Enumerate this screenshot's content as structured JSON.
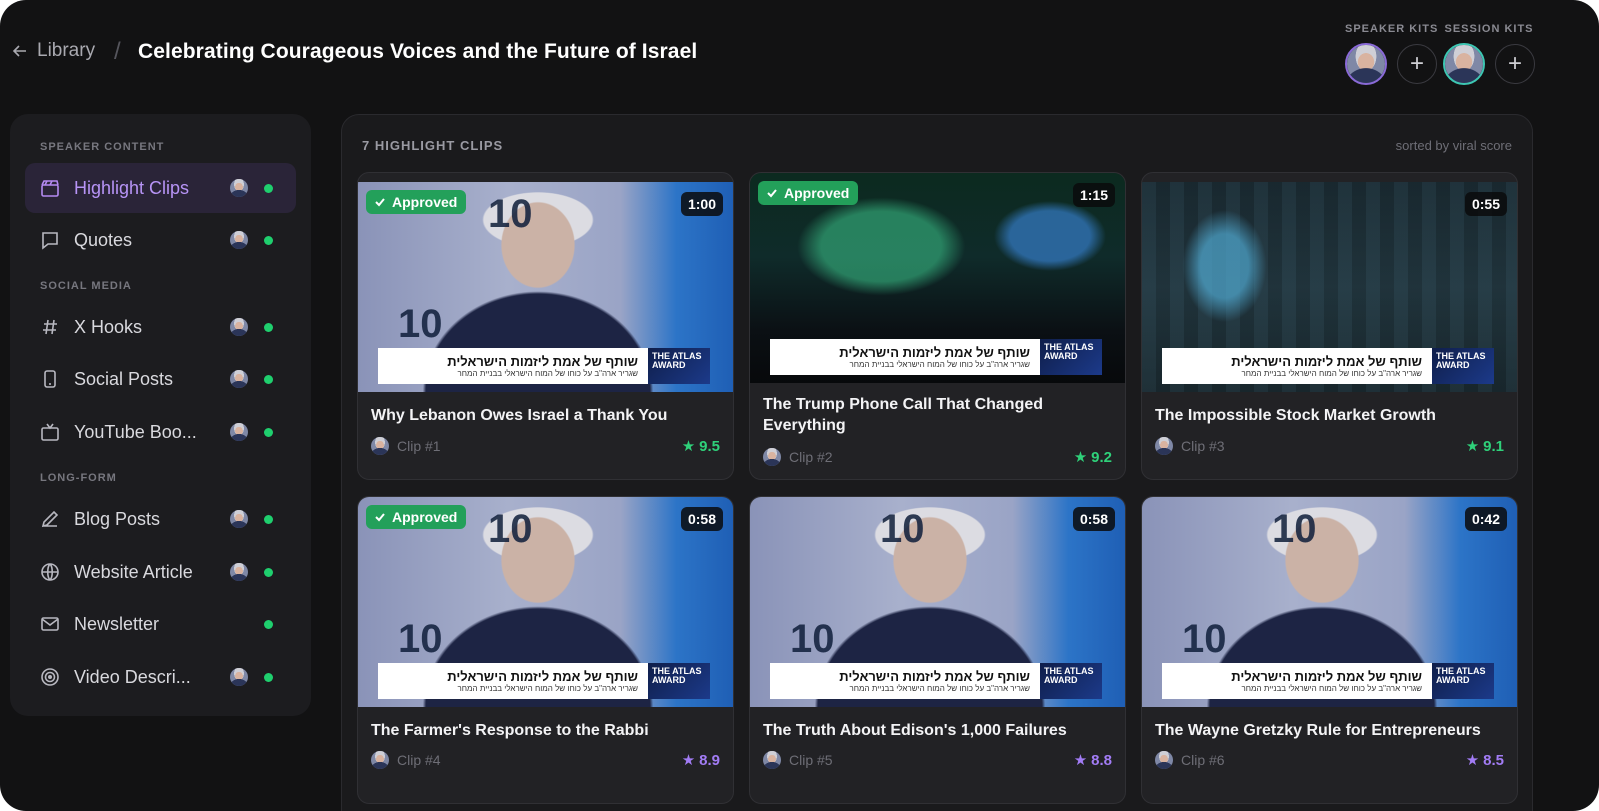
{
  "header": {
    "back_label": "Library",
    "title": "Celebrating Courageous Voices and the Future of Israel",
    "speaker_kits_label": "SPEAKER KITS",
    "session_kits_label": "SESSION KITS"
  },
  "sidebar": {
    "sections": {
      "speaker_content": "SPEAKER CONTENT",
      "social_media": "SOCIAL MEDIA",
      "long_form": "LONG-FORM"
    },
    "items": [
      {
        "label": "Highlight Clips",
        "icon": "clapperboard-icon",
        "active": true,
        "avatar": true
      },
      {
        "label": "Quotes",
        "icon": "speech-bubble-icon",
        "active": false,
        "avatar": true
      },
      {
        "label": "X Hooks",
        "icon": "hashtag-icon",
        "active": false,
        "avatar": true
      },
      {
        "label": "Social Posts",
        "icon": "phone-icon",
        "active": false,
        "avatar": true
      },
      {
        "label": "YouTube Boo...",
        "icon": "tv-icon",
        "active": false,
        "avatar": true
      },
      {
        "label": "Blog Posts",
        "icon": "pen-icon",
        "active": false,
        "avatar": true
      },
      {
        "label": "Website Article",
        "icon": "globe-icon",
        "active": false,
        "avatar": true
      },
      {
        "label": "Newsletter",
        "icon": "mail-icon",
        "active": false,
        "avatar": false
      },
      {
        "label": "Video Descri...",
        "icon": "target-icon",
        "active": false,
        "avatar": true
      }
    ],
    "status_color": "#1fcf6e"
  },
  "main": {
    "title": "7 HIGHLIGHT CLIPS",
    "sort_label": "sorted by viral score",
    "clips": [
      {
        "title": "Why Lebanon Owes Israel a Thank You",
        "clip": "Clip #1",
        "duration": "1:00",
        "score": "9.5",
        "approved": true,
        "approved_label": "Approved",
        "scene": "speaker",
        "score_color": "green"
      },
      {
        "title": "The Trump Phone Call That Changed Everything",
        "clip": "Clip #2",
        "duration": "1:15",
        "score": "9.2",
        "approved": true,
        "approved_label": "Approved",
        "scene": "stage",
        "score_color": "green"
      },
      {
        "title": "The Impossible Stock Market Growth",
        "clip": "Clip #3",
        "duration": "0:55",
        "score": "9.1",
        "approved": false,
        "approved_label": "",
        "scene": "crowd",
        "score_color": "green"
      },
      {
        "title": "The Farmer's Response to the Rabbi",
        "clip": "Clip #4",
        "duration": "0:58",
        "score": "8.9",
        "approved": true,
        "approved_label": "Approved",
        "scene": "speaker",
        "score_color": "purple"
      },
      {
        "title": "The Truth About Edison's 1,000 Failures",
        "clip": "Clip #5",
        "duration": "0:58",
        "score": "8.8",
        "approved": false,
        "approved_label": "",
        "scene": "speaker",
        "score_color": "purple"
      },
      {
        "title": "The Wayne Gretzky Rule for Entrepreneurs",
        "clip": "Clip #6",
        "duration": "0:42",
        "score": "8.5",
        "approved": false,
        "approved_label": "",
        "scene": "speaker",
        "score_color": "purple"
      }
    ],
    "banner_main": "שותף של אמת ליזמות הישראלית",
    "banner_sub": "שגריר ארה\"ב על כוחו של המוח הישראלי בבניית המחר",
    "banner_logo": "THE ATLAS AWARD",
    "backdrop_num": "10"
  },
  "colors": {
    "accent_purple": "#b794f6",
    "approved_green": "#23a05a",
    "score_green": "#2fd17a",
    "score_purple": "#a27cf5"
  }
}
